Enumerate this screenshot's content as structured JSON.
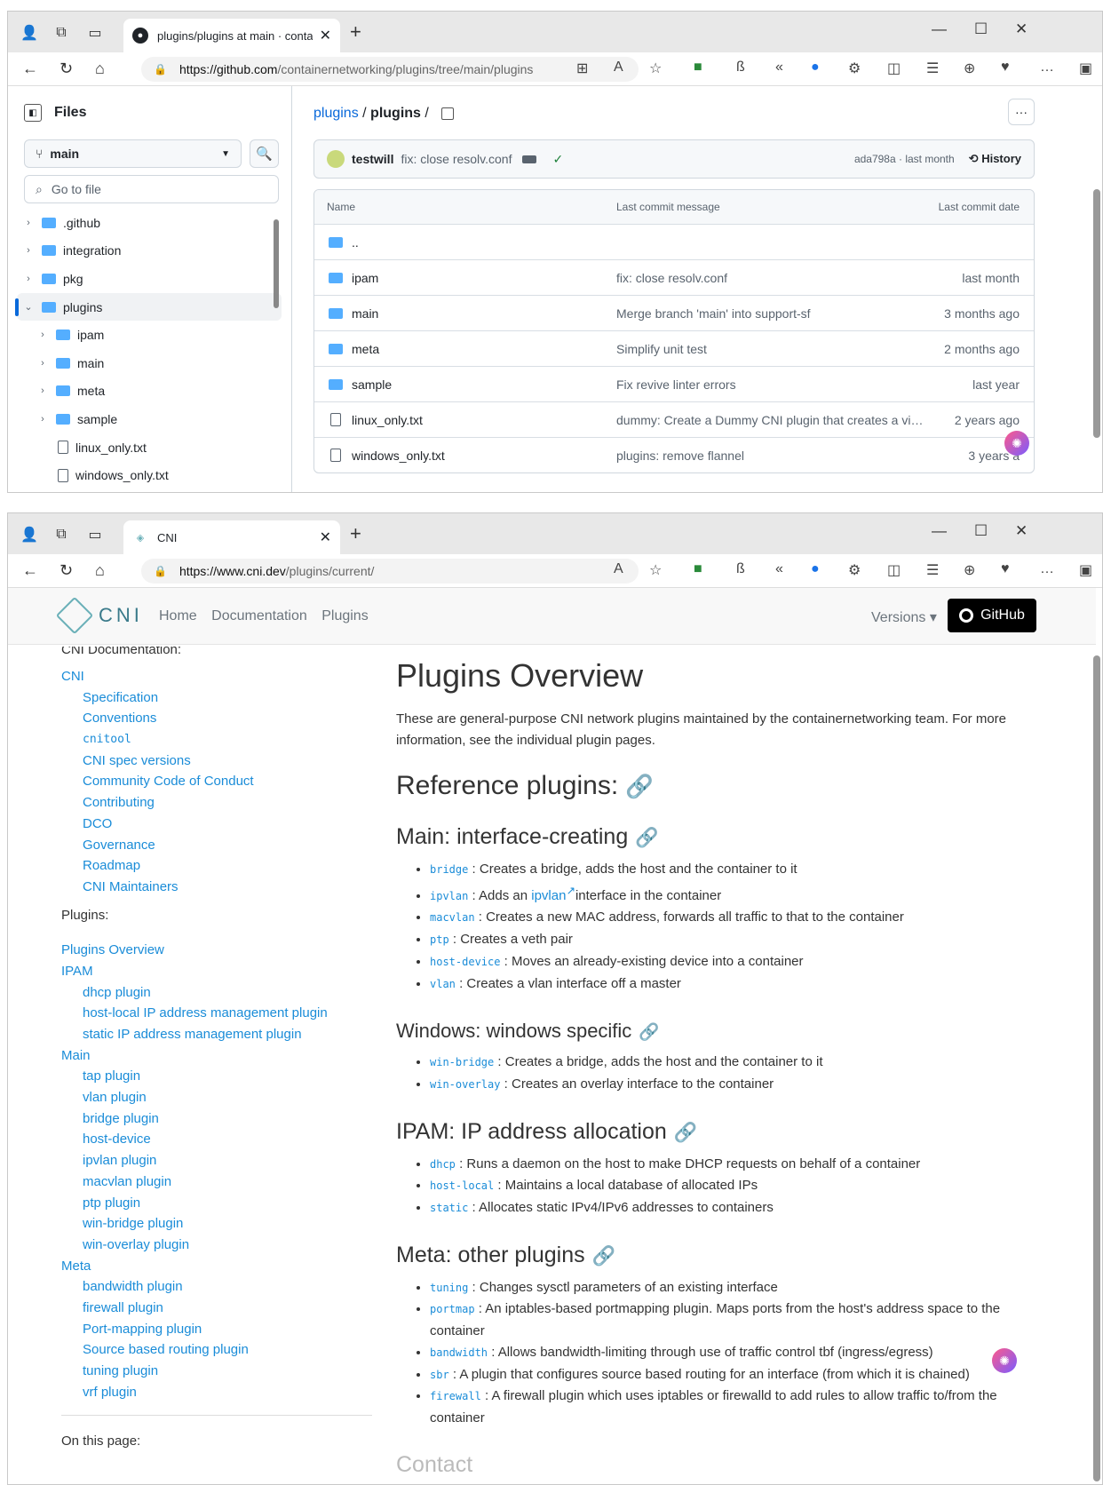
{
  "win1": {
    "tab_title": "plugins/plugins at main · contain",
    "url_host": "https://github.com",
    "url_path": "/containernetworking/plugins/tree/main/plugins",
    "sidebar": {
      "title": "Files",
      "branch": "main",
      "goto_placeholder": "Go to file",
      "tree": [
        {
          "label": ".github",
          "type": "folder",
          "level": 0,
          "open": false
        },
        {
          "label": "integration",
          "type": "folder",
          "level": 0,
          "open": false
        },
        {
          "label": "pkg",
          "type": "folder",
          "level": 0,
          "open": false
        },
        {
          "label": "plugins",
          "type": "folder",
          "level": 0,
          "open": true
        },
        {
          "label": "ipam",
          "type": "folder",
          "level": 1,
          "open": false
        },
        {
          "label": "main",
          "type": "folder",
          "level": 1,
          "open": false
        },
        {
          "label": "meta",
          "type": "folder",
          "level": 1,
          "open": false
        },
        {
          "label": "sample",
          "type": "folder",
          "level": 1,
          "open": false
        },
        {
          "label": "linux_only.txt",
          "type": "file",
          "level": 1
        },
        {
          "label": "windows_only.txt",
          "type": "file",
          "level": 1
        }
      ]
    },
    "breadcrumb": {
      "repo": "plugins",
      "sep": " / ",
      "dir": "plugins",
      "trail": " /"
    },
    "commit": {
      "author": "testwill",
      "message": "fix: close resolv.conf",
      "sha_time": "ada798a · last month",
      "history": "History"
    },
    "table": {
      "headers": [
        "Name",
        "Last commit message",
        "Last commit date"
      ],
      "rows": [
        {
          "name": "..",
          "type": "folder",
          "msg": "",
          "date": ""
        },
        {
          "name": "ipam",
          "type": "folder",
          "msg": "fix: close resolv.conf",
          "date": "last month"
        },
        {
          "name": "main",
          "type": "folder",
          "msg": "Merge branch 'main' into support-sf",
          "date": "3 months ago"
        },
        {
          "name": "meta",
          "type": "folder",
          "msg": "Simplify unit test",
          "date": "2 months ago"
        },
        {
          "name": "sample",
          "type": "folder",
          "msg": "Fix revive linter errors",
          "date": "last year"
        },
        {
          "name": "linux_only.txt",
          "type": "file",
          "msg": "dummy: Create a Dummy CNI plugin that creates a virtual ...",
          "date": "2 years ago"
        },
        {
          "name": "windows_only.txt",
          "type": "file",
          "msg": "plugins: remove flannel",
          "date": "3 years a"
        }
      ]
    }
  },
  "win2": {
    "tab_title": "CNI",
    "url_host": "https://www.cni.dev",
    "url_path": "/plugins/current/",
    "nav": {
      "logo": "CNI",
      "links": [
        "Home",
        "Documentation",
        "Plugins"
      ],
      "versions": "Versions ▾",
      "github": "GitHub"
    },
    "sidebar": {
      "top_cut": "CNI Documentation:",
      "doc_links": [
        {
          "label": "CNI",
          "indent": false
        },
        {
          "label": "Specification",
          "indent": true
        },
        {
          "label": "Conventions",
          "indent": true
        },
        {
          "label": "cnitool",
          "indent": true,
          "mono": true
        },
        {
          "label": "CNI spec versions",
          "indent": true
        },
        {
          "label": "Community Code of Conduct",
          "indent": true
        },
        {
          "label": "Contributing",
          "indent": true
        },
        {
          "label": "DCO",
          "indent": true
        },
        {
          "label": "Governance",
          "indent": true
        },
        {
          "label": "Roadmap",
          "indent": true
        },
        {
          "label": "CNI Maintainers",
          "indent": true
        }
      ],
      "plugins_heading": "Plugins:",
      "plugin_links": [
        {
          "label": "Plugins Overview",
          "indent": false
        },
        {
          "label": "IPAM",
          "indent": false
        },
        {
          "label": "dhcp plugin",
          "indent": true
        },
        {
          "label": "host-local IP address management plugin",
          "indent": true
        },
        {
          "label": "static IP address management plugin",
          "indent": true
        },
        {
          "label": "Main",
          "indent": false
        },
        {
          "label": "tap plugin",
          "indent": true
        },
        {
          "label": "vlan plugin",
          "indent": true
        },
        {
          "label": "bridge plugin",
          "indent": true
        },
        {
          "label": "host-device",
          "indent": true
        },
        {
          "label": "ipvlan plugin",
          "indent": true
        },
        {
          "label": "macvlan plugin",
          "indent": true
        },
        {
          "label": "ptp plugin",
          "indent": true
        },
        {
          "label": "win-bridge plugin",
          "indent": true
        },
        {
          "label": "win-overlay plugin",
          "indent": true
        },
        {
          "label": "Meta",
          "indent": false
        },
        {
          "label": "bandwidth plugin",
          "indent": true
        },
        {
          "label": "firewall plugin",
          "indent": true
        },
        {
          "label": "Port-mapping plugin",
          "indent": true
        },
        {
          "label": "Source based routing plugin",
          "indent": true
        },
        {
          "label": "tuning plugin",
          "indent": true
        },
        {
          "label": "vrf plugin",
          "indent": true
        }
      ],
      "on_this_page": "On this page:"
    },
    "content": {
      "title": "Plugins Overview",
      "intro": "These are general-purpose CNI network plugins maintained by the containernetworking team. For more information, see the individual plugin pages.",
      "ref_heading": "Reference plugins:",
      "sections": [
        {
          "heading": "Main: interface-creating",
          "size": "h3",
          "items": [
            {
              "code": "bridge",
              "text": " : Creates a bridge, adds the host and the container to it"
            },
            {
              "code": "ipvlan",
              "text": " : Adds an ",
              "link": "ipvlan",
              "text2": "interface in the container"
            },
            {
              "code": "macvlan",
              "text": " : Creates a new MAC address, forwards all traffic to that to the container"
            },
            {
              "code": "ptp",
              "text": " : Creates a veth pair"
            },
            {
              "code": "host-device",
              "text": " : Moves an already-existing device into a container"
            },
            {
              "code": "vlan",
              "text": " : Creates a vlan interface off a master"
            }
          ]
        },
        {
          "heading": "Windows: windows specific",
          "size": "h4",
          "items": [
            {
              "code": "win-bridge",
              "text": " : Creates a bridge, adds the host and the container to it"
            },
            {
              "code": "win-overlay",
              "text": " : Creates an overlay interface to the container"
            }
          ]
        },
        {
          "heading": "IPAM: IP address allocation",
          "size": "h3",
          "items": [
            {
              "code": "dhcp",
              "text": " : Runs a daemon on the host to make DHCP requests on behalf of a container"
            },
            {
              "code": "host-local",
              "text": " : Maintains a local database of allocated IPs"
            },
            {
              "code": "static",
              "text": " : Allocates static IPv4/IPv6 addresses to containers"
            }
          ]
        },
        {
          "heading": "Meta: other plugins",
          "size": "h3",
          "items": [
            {
              "code": "tuning",
              "text": " : Changes sysctl parameters of an existing interface"
            },
            {
              "code": "portmap",
              "text": " : An iptables-based portmapping plugin. Maps ports from the host's address space to the container"
            },
            {
              "code": "bandwidth",
              "text": " : Allows bandwidth-limiting through use of traffic control tbf (ingress/egress)"
            },
            {
              "code": "sbr",
              "text": " : A plugin that configures source based routing for an interface (from which it is chained)"
            },
            {
              "code": "firewall",
              "text": " : A firewall plugin which uses iptables or firewalld to add rules to allow traffic to/from the container"
            }
          ]
        }
      ],
      "cut_heading": "Contact"
    }
  }
}
